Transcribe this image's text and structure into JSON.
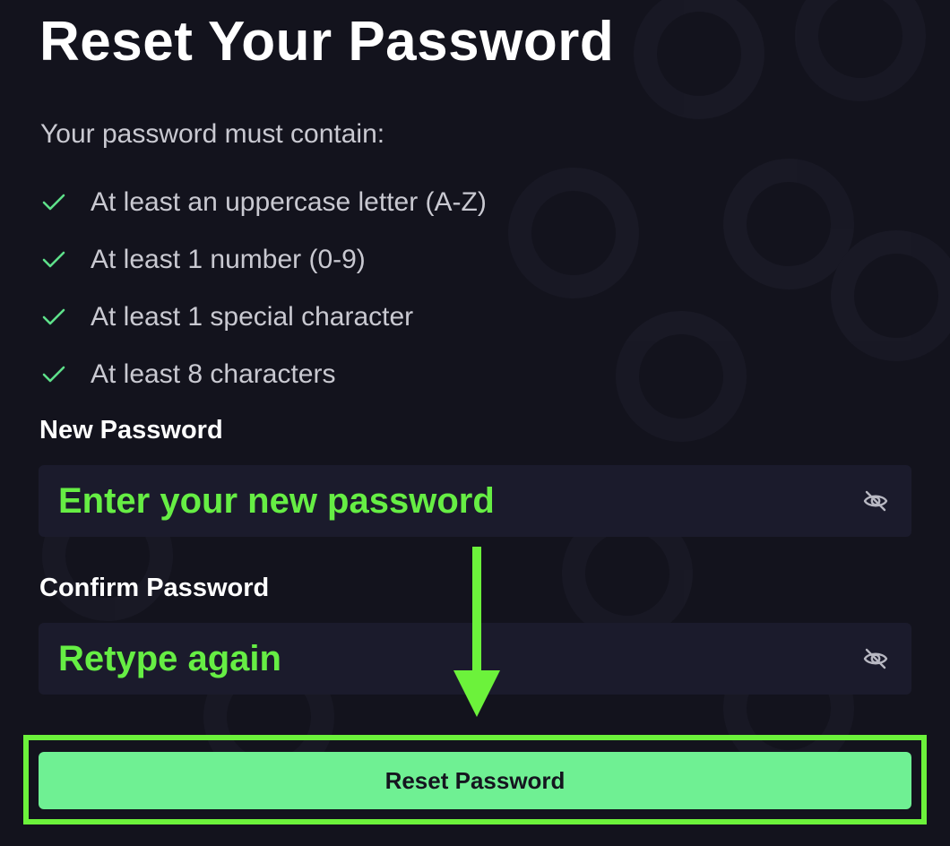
{
  "header": {
    "title": "Reset Your Password"
  },
  "requirements": {
    "intro": "Your password must contain:",
    "items": [
      {
        "label": "At least an uppercase letter (A-Z)",
        "met": true
      },
      {
        "label": "At least 1 number (0-9)",
        "met": true
      },
      {
        "label": "At least 1 special character",
        "met": true
      },
      {
        "label": "At least 8 characters",
        "met": true
      }
    ],
    "check_icon": "check-icon"
  },
  "form": {
    "new_password": {
      "label": "New Password",
      "placeholder": "Enter your new password",
      "value": "",
      "toggle_icon": "eye-slash-icon"
    },
    "confirm_password": {
      "label": "Confirm Password",
      "placeholder": "Retype again",
      "value": "",
      "toggle_icon": "eye-slash-icon"
    },
    "submit_label": "Reset Password"
  },
  "colors": {
    "background": "#13131d",
    "field_background": "#1b1b2c",
    "check": "#5ee08a",
    "placeholder": "#66ee44",
    "button": "#6ff093",
    "highlight": "#6cf23b",
    "arrow": "#6cf23b"
  }
}
